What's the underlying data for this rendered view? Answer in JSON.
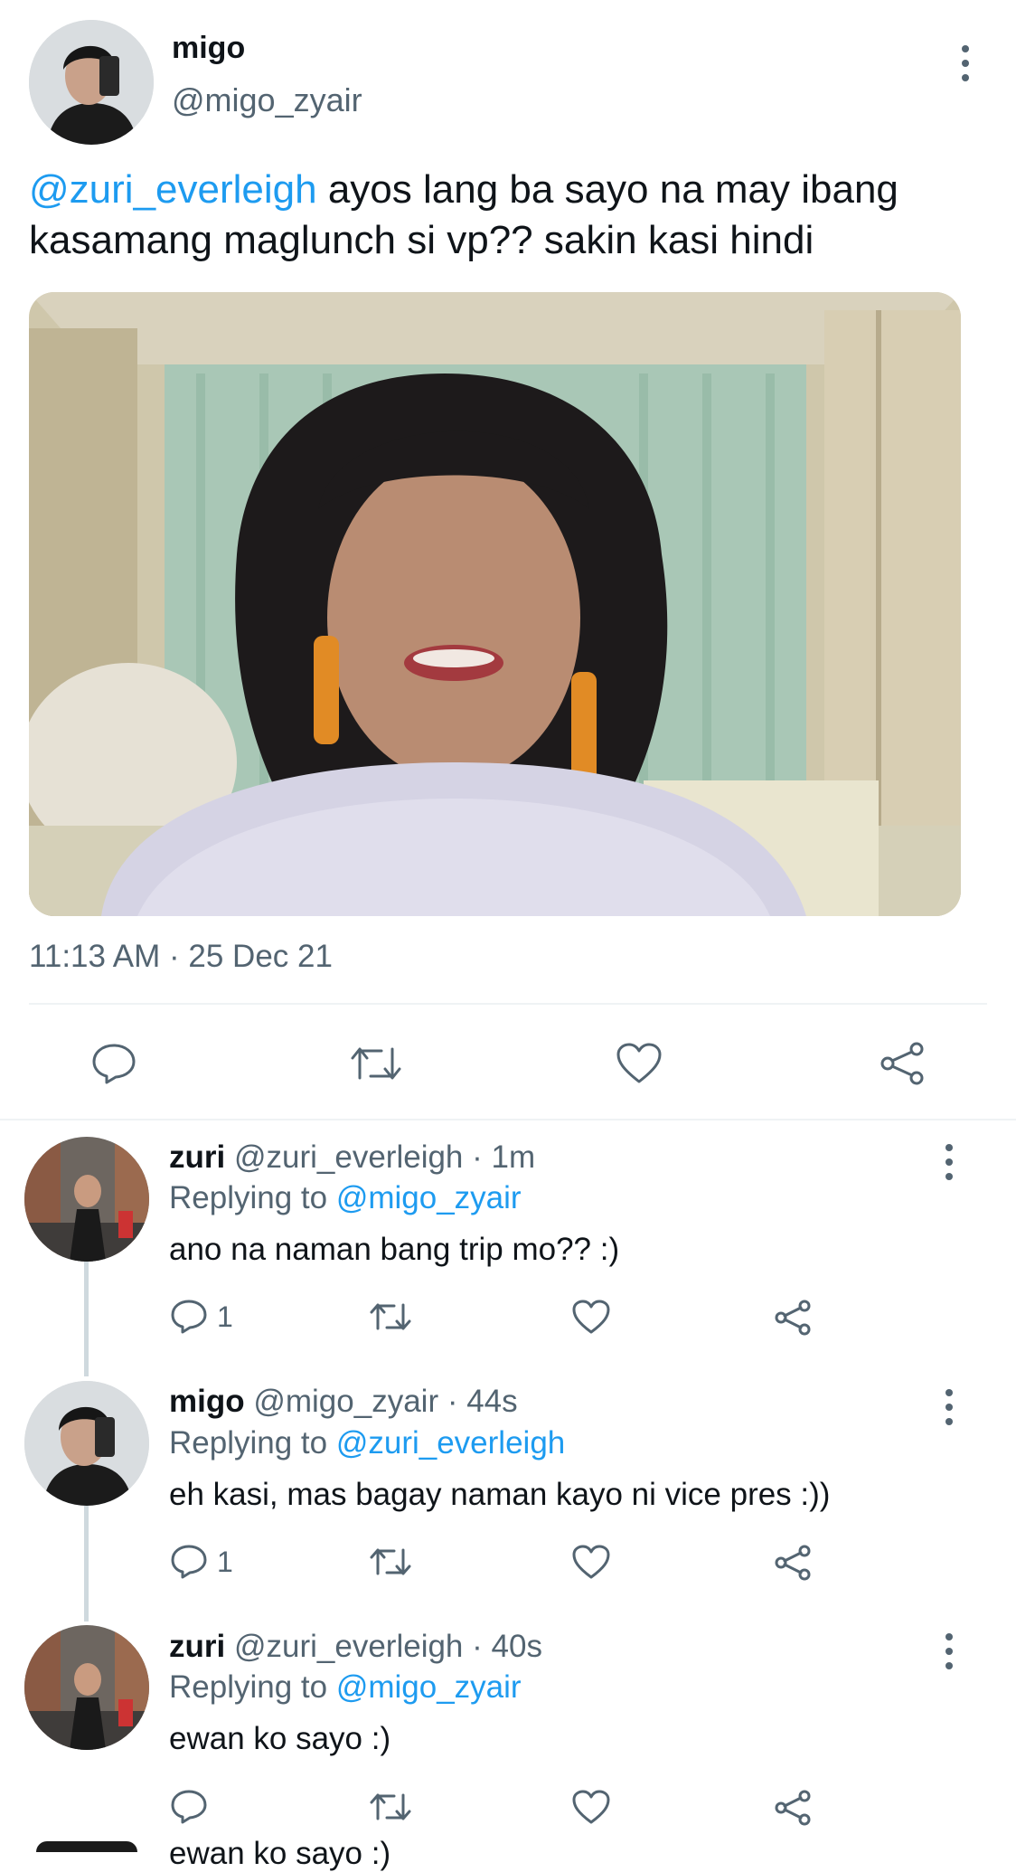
{
  "main_tweet": {
    "author_name": "migo",
    "author_handle": "@migo_zyair",
    "mention": "@zuri_everleigh",
    "text": " ayos lang ba sayo na may ibang kasamang maglunch si vp?? sakin kasi hindi",
    "timestamp": "11:13 AM · 25 Dec 21"
  },
  "replies": [
    {
      "name": "zuri",
      "handle": "@zuri_everleigh",
      "time": " · 1m",
      "replying_label": "Replying to ",
      "replying_to": "@migo_zyair",
      "text": "ano na naman bang trip mo?? :)",
      "reply_count": "1"
    },
    {
      "name": "migo",
      "handle": "@migo_zyair",
      "time": " · 44s",
      "replying_label": "Replying to ",
      "replying_to": "@zuri_everleigh",
      "text": "eh kasi, mas bagay naman kayo ni vice pres :))",
      "reply_count": "1"
    },
    {
      "name": "zuri",
      "handle": "@zuri_everleigh",
      "time": " · 40s",
      "replying_label": "Replying to ",
      "replying_to": "@migo_zyair",
      "text": "ewan ko sayo :)",
      "reply_count": ""
    }
  ],
  "partial_next_reply_text": "ewan ko sayo :)",
  "icons": [
    "more-vertical-icon",
    "reply-icon",
    "retweet-icon",
    "like-icon",
    "share-icon"
  ],
  "colors": {
    "link": "#1d9bf0",
    "secondary_text": "#536471",
    "divider": "#eff3f4"
  }
}
